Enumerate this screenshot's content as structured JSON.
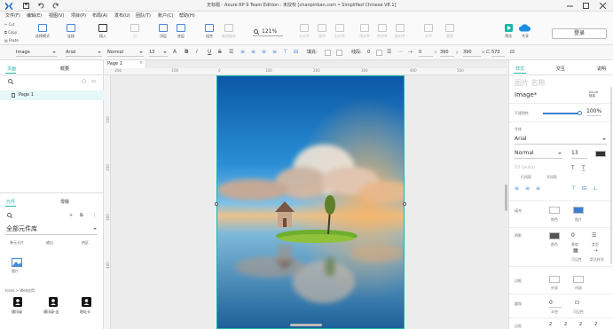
{
  "window": {
    "title": "无标题 - Axure RP 9 Team Edition : 未授权  [chanpinban.com • Simplified Chinese V8.1]",
    "controls": [
      "minimize",
      "maximize",
      "close"
    ]
  },
  "menu": {
    "items": [
      "文件(F)",
      "编辑(E)",
      "视图(V)",
      "项目(P)",
      "布局(A)",
      "发布(U)",
      "团队(T)",
      "账户(C)",
      "帮助(H)"
    ]
  },
  "toolbar": {
    "clipboard": [
      "Cut",
      "Copy",
      "Paste"
    ],
    "buttons": [
      "选择模式",
      "连接",
      "插入",
      "点",
      "顶层",
      "底层",
      "组合",
      "取消组合",
      "左对齐",
      "居中",
      "右对齐",
      "顶对齐",
      "中对齐",
      "底对齐",
      "水平",
      "垂直"
    ],
    "zoom": "121%",
    "preview_label": "预览",
    "share_label": "共享",
    "login_label": "登录"
  },
  "format": {
    "element_type": "Image",
    "font_family": "Arial",
    "font_style": "Normal",
    "font_size": "13",
    "fill_label": "填充:",
    "stroke_label": "线段:",
    "stroke_value": "0",
    "x": "0",
    "y": "390",
    "w": "570",
    "x_label": "x",
    "y_label": "y",
    "w_label": "w"
  },
  "left": {
    "tabs": [
      "页面",
      "概要"
    ],
    "page_item": "Page 1",
    "lib_tabs": [
      "元件",
      "母版"
    ],
    "library_select": "全部元件库",
    "widgets": [
      "单元卡片",
      "输出",
      "热区"
    ],
    "image_widget": "图片",
    "icons_group": "Icons > Web应用",
    "bottom_widgets": [
      "通讯录",
      "通讯录-全",
      "地址卡"
    ]
  },
  "canvas": {
    "tab": "Page 1",
    "ruler_h": [
      "-200",
      "-100",
      "0",
      "100",
      "200",
      "300",
      "400",
      "500"
    ],
    "ruler_v": [
      "100",
      "200",
      "300",
      "400"
    ]
  },
  "right": {
    "tabs": [
      "样式",
      "交互",
      "说明"
    ],
    "name_placeholder": "图片 名称",
    "element_type": "Image*",
    "link_label": "Axure\n链接",
    "opacity_label": "不透明性",
    "opacity_value": "100%",
    "font_section": "字体",
    "font_family": "Arial",
    "font_style": "Normal",
    "font_size": "13",
    "line_height": "15 (auto)",
    "line_height_label": "行间距",
    "char_spacing_label": "字间距",
    "fill_label": "填充",
    "fill_sub": [
      "颜色",
      "图片"
    ],
    "shadow_label": "阴影",
    "shadow_sub": [
      "颜色",
      "0",
      "厚度",
      "类型",
      "可见性",
      "箭头样式"
    ],
    "border_label": "边框",
    "border_sub": [
      "外部",
      "内部"
    ],
    "radius_label": "圆角",
    "radius_value": "0",
    "radius_sub": [
      "半径",
      "可见性"
    ],
    "padding_label": "边距",
    "padding_values": [
      "2",
      "2",
      "2",
      "2"
    ],
    "colors": {
      "accent": "#1fb5a9",
      "fill_color": "#ffffff",
      "stroke_color": "#333333"
    }
  }
}
